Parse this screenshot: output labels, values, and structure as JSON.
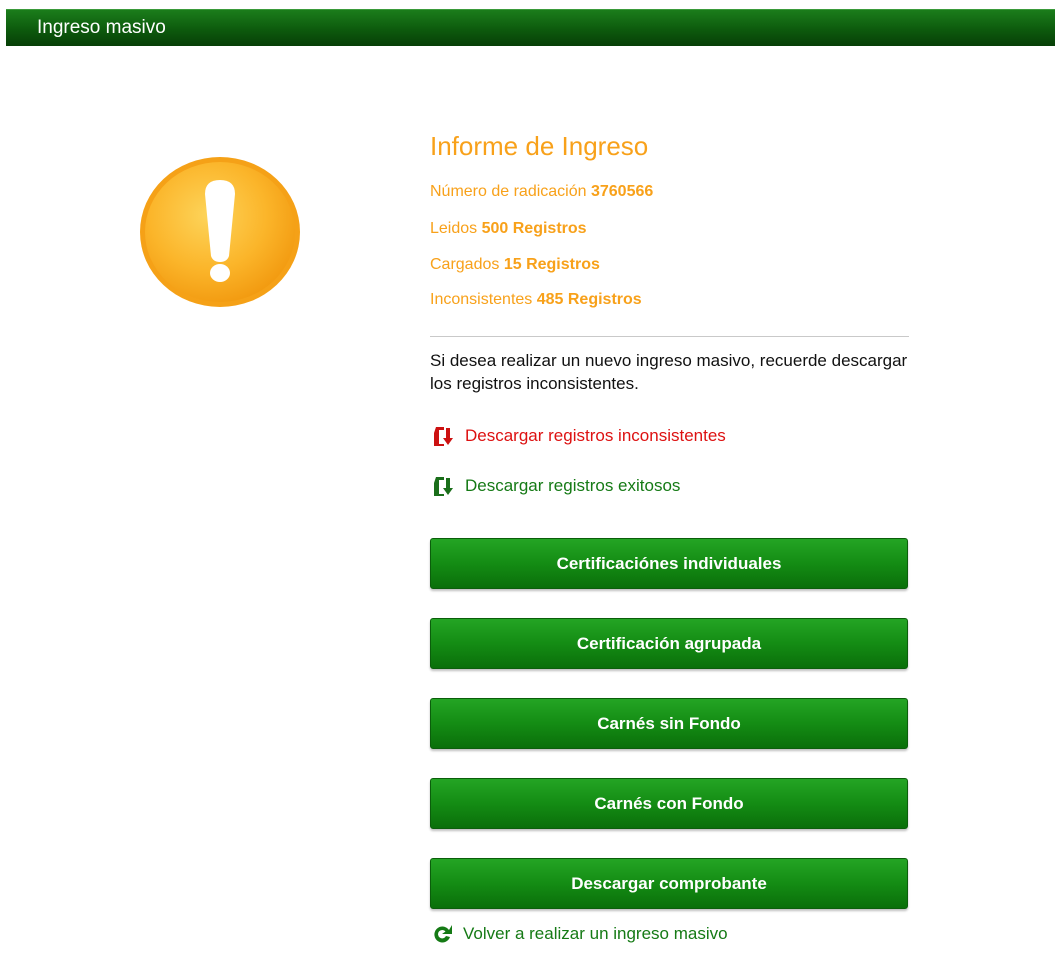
{
  "header": {
    "title": "Ingreso masivo"
  },
  "report": {
    "title": "Informe de Ingreso",
    "radicacion": {
      "label": "Número de radicación",
      "value": "3760566"
    },
    "leidos": {
      "label": "Leidos",
      "value": "500 Registros"
    },
    "cargados": {
      "label": "Cargados",
      "value": "15 Registros"
    },
    "inconsistentes": {
      "label": "Inconsistentes",
      "value": "485 Registros"
    }
  },
  "notice": "Si desea realizar un nuevo ingreso masivo, recuerde descargar los registros inconsistentes.",
  "links": {
    "download_inconsistent": "Descargar registros inconsistentes",
    "download_success": "Descargar registros exitosos",
    "back": "Volver a realizar un ingreso masivo"
  },
  "buttons": {
    "individual": "Certificaciónes individuales",
    "grouped": "Certificación agrupada",
    "carnes_sin_fondo": "Carnés sin Fondo",
    "carnes_con_fondo": "Carnés con Fondo",
    "receipt": "Descargar comprobante"
  },
  "icons": {
    "status": "warning-icon",
    "download_inconsistent": "file-download-icon",
    "download_success": "file-download-icon",
    "back": "refresh-icon"
  },
  "colors": {
    "header": "#0d5a0d",
    "accent": "#f8a11a",
    "error": "#dd1111",
    "success": "#157a15",
    "button": "#148c14"
  }
}
